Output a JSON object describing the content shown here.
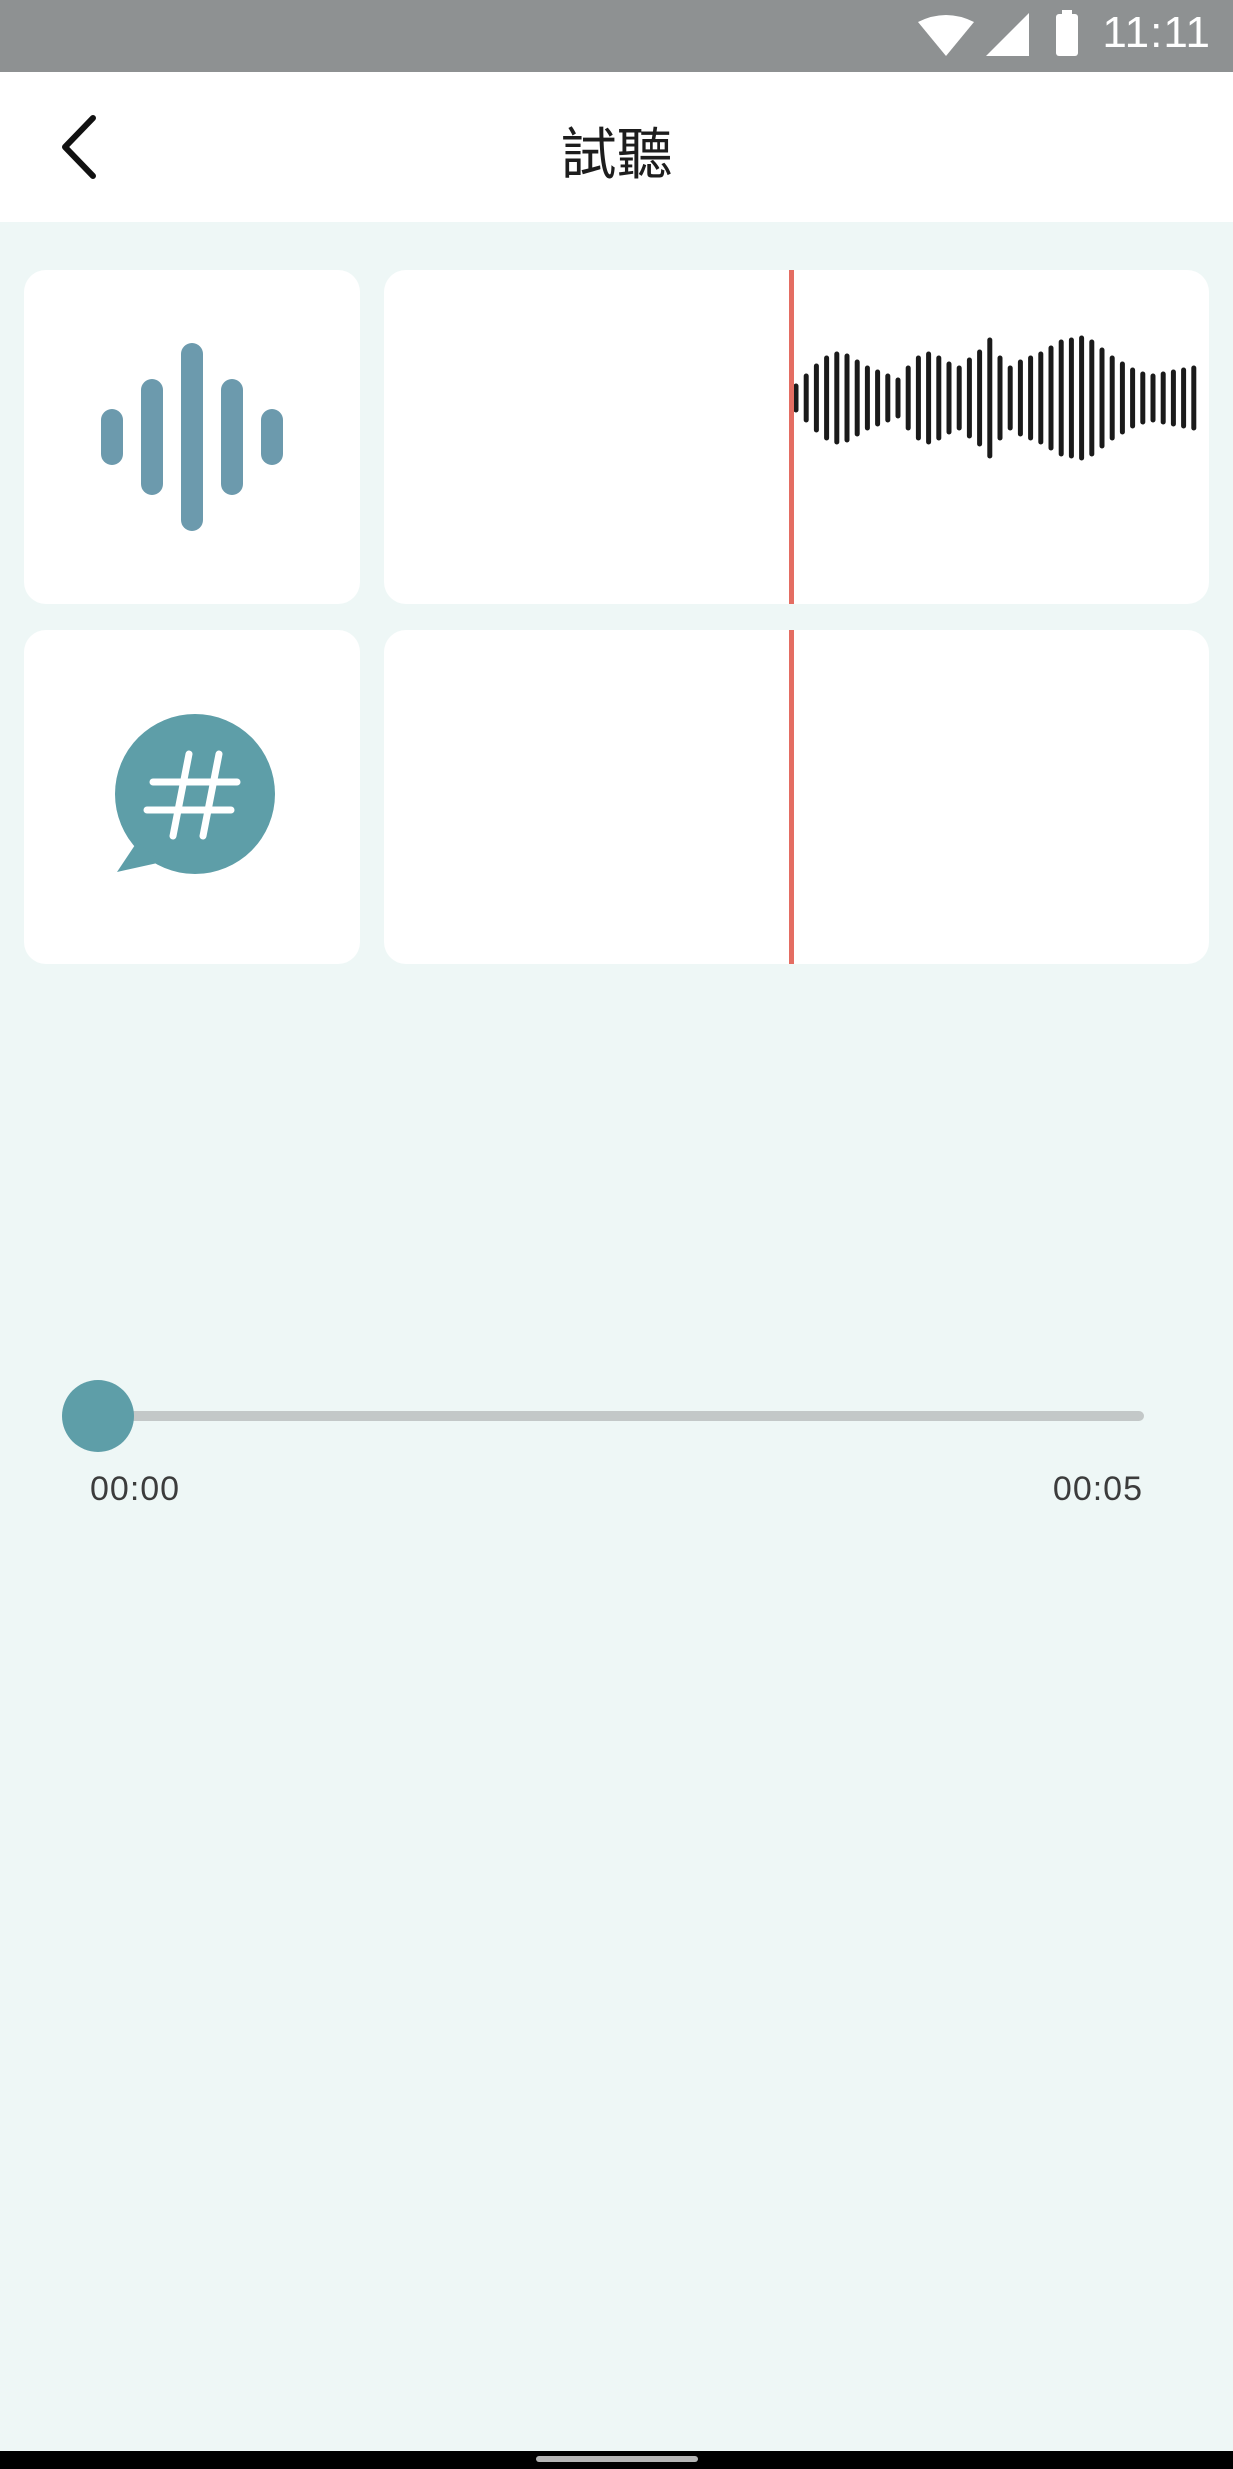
{
  "status_bar": {
    "time": "11:11",
    "icons": [
      "wifi-icon",
      "cell-signal-icon",
      "battery-icon"
    ]
  },
  "header": {
    "title": "試聽",
    "back_icon": "chevron-left-icon"
  },
  "tracks": [
    {
      "icon": "audio-wave-icon",
      "type": "audio"
    },
    {
      "icon": "hashtag-chat-icon",
      "type": "text"
    }
  ],
  "player": {
    "position": "00:00",
    "duration": "00:05",
    "progress_fraction": 0
  },
  "colors": {
    "accent": "#5e9ea8",
    "icon_blue": "#6c9aad",
    "playhead": "#e46d62",
    "background": "#eef7f6",
    "waveform": "#1a1a1a"
  }
}
